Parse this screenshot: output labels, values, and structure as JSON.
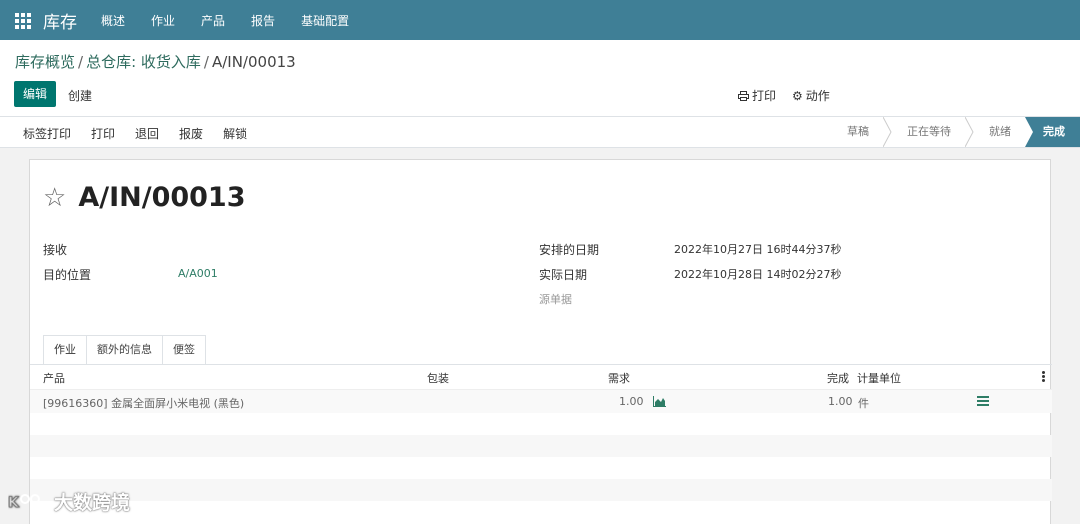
{
  "app": {
    "brand": "库存",
    "menu": [
      "概述",
      "作业",
      "产品",
      "报告",
      "基础配置"
    ]
  },
  "breadcrumb": {
    "parts": [
      "库存概览",
      "总仓库: 收货入库"
    ],
    "current": "A/IN/00013"
  },
  "toolbar": {
    "edit_label": "编辑",
    "create_label": "创建",
    "print_label": "打印",
    "action_label": "动作"
  },
  "status_buttons": [
    "标签打印",
    "打印",
    "退回",
    "报废",
    "解锁"
  ],
  "stages": [
    "草稿",
    "正在等待",
    "就绪",
    "完成"
  ],
  "record": {
    "title": "A/IN/00013",
    "receive_label": "接收",
    "dest_label": "目的位置",
    "dest_value": "A/A001",
    "scheduled_label": "安排的日期",
    "scheduled_value": "2022年10月27日 16时44分37秒",
    "actual_label": "实际日期",
    "actual_value": "2022年10月28日 14时02分27秒",
    "source_label": "源单据"
  },
  "tabs": [
    "作业",
    "额外的信息",
    "便签"
  ],
  "table": {
    "headers": {
      "product": "产品",
      "package": "包装",
      "demand": "需求",
      "done": "完成",
      "uom": "计量单位"
    },
    "rows": [
      {
        "product": "[99616360] 金属全面屏小米电视 (黑色)",
        "demand": "1.00",
        "done": "1.00",
        "uom": "件"
      }
    ]
  },
  "watermark": "大数跨境",
  "colors": {
    "topbar": "#3f7f96",
    "primary_button": "#00766f",
    "link": "#2e7d66"
  }
}
